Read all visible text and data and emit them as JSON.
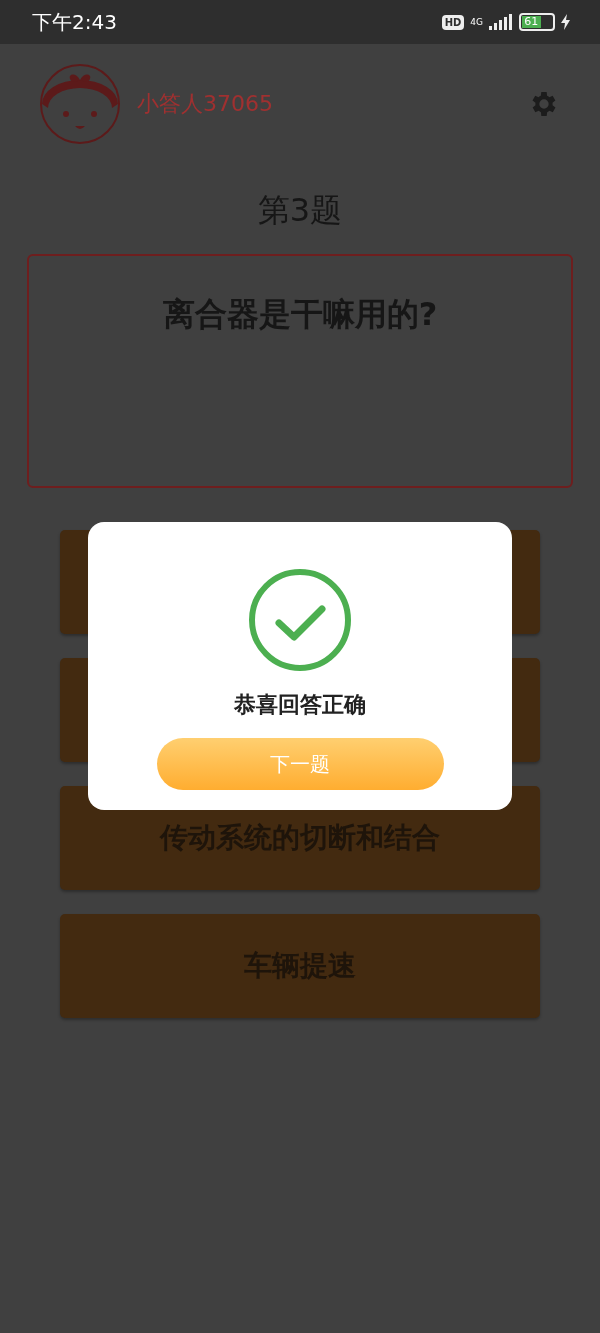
{
  "status_bar": {
    "time": "下午2:43",
    "hd_badge": "HD",
    "network": "4G",
    "battery_text": "61",
    "charging": true
  },
  "header": {
    "username": "小答人37065"
  },
  "question": {
    "number_title": "第3题",
    "text": "离合器是干嘛用的?"
  },
  "options": [
    {
      "kind": "covered"
    },
    {
      "kind": "covered"
    },
    {
      "kind": "answer",
      "label": "传动系统的切断和结合"
    },
    {
      "kind": "answer",
      "label": "车辆提速"
    }
  ],
  "dialog": {
    "message": "恭喜回答正确",
    "button": "下一题"
  }
}
